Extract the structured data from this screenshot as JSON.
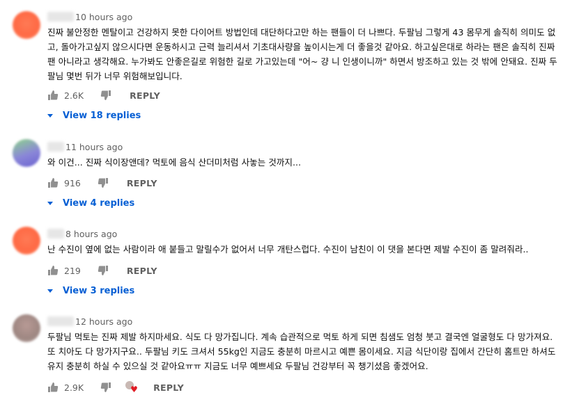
{
  "comments": [
    {
      "time": "10 hours ago",
      "lines": [
        "진짜 불안정한 멘탈이고 건강하지 못한 다이어트 방법인데 대단하다고만 하는 팬들이 더 나쁘다. 두팔님 그렇게 43 몸무게 솔직히 의미도 없",
        "고, 돌아가고싶지 않으시다면 운동하시고 근력 늘리셔서 기초대사량을 높이시는게 더 좋을것 같아요. 하고싶은대로 하라는 팬은 솔직히 진짜",
        "팬 아니라고 생각해요. 누가봐도 안좋은길로 위험한 길로 가고있는데 \"어~ 걍 니 인생이니까\" 하면서 방조하고 있는 것 밖에 안돼요. 진짜 두",
        "팔님 몇번 뒤가 너무 위험해보입니다."
      ],
      "likes": "2.6K",
      "reply_label": "REPLY",
      "view_replies": "View 18 replies"
    },
    {
      "time": "11 hours ago",
      "lines": [
        "와 이건... 진짜 식이장앤데? 먹토에 음식 산더미처럼 사놓는 것까지..."
      ],
      "likes": "916",
      "reply_label": "REPLY",
      "view_replies": "View 4 replies"
    },
    {
      "time": "8 hours ago",
      "lines": [
        "난 수진이 옆에 없는 사람이라 애 붙들고 말릴수가 없어서 너무 개탄스럽다. 수진이 남친이 이 댓을 본다면 제발 수진이 좀 말려줘라.."
      ],
      "likes": "219",
      "reply_label": "REPLY",
      "view_replies": "View 3 replies"
    },
    {
      "time": "12 hours ago",
      "lines": [
        "두팔님 먹토는 진짜 제발 하지마세요. 식도 다 망가집니다. 계속 습관적으로 먹토 하게 되면 침샘도 엄청 붓고 결국엔 얼굴형도 다 망가져요.",
        "또 치아도 다 망가지구요.. 두팔님 키도 크셔서 55kg인 지금도 충분히 마르시고 예쁜 몸이세요. 지금 식단이랑 집에서 간단히 홈트만 하셔도",
        "유지 충분히 하실 수 있으실 것 같아요ㅠㅠ 지금도 너무 예쁘세요 두팔님 건강부터 꼭 챙기셨음 좋겠어요."
      ],
      "likes": "2.9K",
      "reply_label": "REPLY"
    }
  ],
  "colors": {
    "link": "#065fd4",
    "meta": "#606060",
    "text": "#0f0f0f",
    "heart": "#e01b24"
  },
  "icons": [
    "thumbs-up-icon",
    "thumbs-down-icon",
    "creator-heart-icon",
    "caret-down-icon"
  ]
}
